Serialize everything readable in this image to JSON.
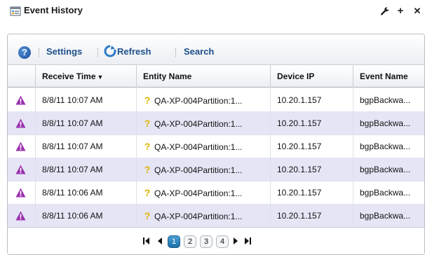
{
  "portlet": {
    "title": "Event History",
    "icon": "event-history-icon",
    "tools": [
      "wrench-icon",
      "plus-icon",
      "close-icon"
    ],
    "tool_glyphs": {
      "plus": "+",
      "close": "✕"
    }
  },
  "toolbar": {
    "help_glyph": "?",
    "settings_label": "Settings",
    "refresh_label": "Refresh",
    "search_label": "Search"
  },
  "grid": {
    "columns": [
      "Receive Time",
      "Entity Name",
      "Device IP",
      "Event Name"
    ],
    "sort_column": "Receive Time",
    "sort_direction": "desc",
    "sort_glyph": "▼",
    "rows": [
      {
        "time": "8/8/11 10:07 AM",
        "entity": "QA-XP-004Partition:1...",
        "ip": "10.20.1.157",
        "event": "bgpBackwa..."
      },
      {
        "time": "8/8/11 10:07 AM",
        "entity": "QA-XP-004Partition:1...",
        "ip": "10.20.1.157",
        "event": "bgpBackwa..."
      },
      {
        "time": "8/8/11 10:07 AM",
        "entity": "QA-XP-004Partition:1...",
        "ip": "10.20.1.157",
        "event": "bgpBackwa..."
      },
      {
        "time": "8/8/11 10:07 AM",
        "entity": "QA-XP-004Partition:1...",
        "ip": "10.20.1.157",
        "event": "bgpBackwa..."
      },
      {
        "time": "8/8/11 10:06 AM",
        "entity": "QA-XP-004Partition:1...",
        "ip": "10.20.1.157",
        "event": "bgpBackwa..."
      },
      {
        "time": "8/8/11 10:06 AM",
        "entity": "QA-XP-004Partition:1...",
        "ip": "10.20.1.157",
        "event": "bgpBackwa..."
      }
    ],
    "entity_glyph": "?",
    "severity_icon": "warning-triangle-icon"
  },
  "pager": {
    "glyphs": {
      "first": "⏮",
      "prev": "◀",
      "next": "▶",
      "last": "⏭"
    },
    "pages": [
      "1",
      "2",
      "3",
      "4"
    ],
    "current_page": "1"
  },
  "colors": {
    "accent": "#1d4f8a",
    "row_alt": "#e5e5f6",
    "severity": "#9b2fb0",
    "active_page": "#2a86c2"
  }
}
